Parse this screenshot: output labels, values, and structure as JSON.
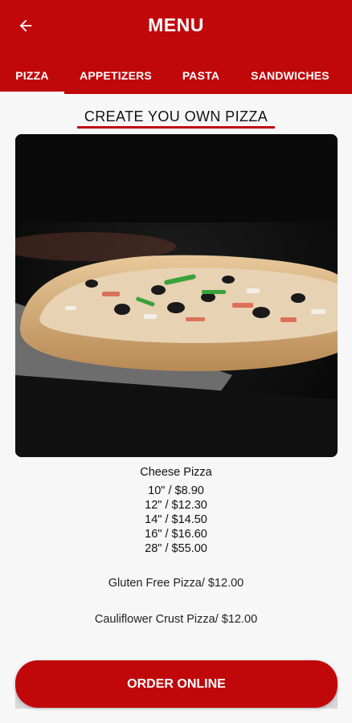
{
  "header": {
    "title": "MENU",
    "back_icon": "arrow-left-icon",
    "color": "#c0080b"
  },
  "tabs": [
    {
      "label": "PIZZA",
      "active": true
    },
    {
      "label": "APPETIZERS",
      "active": false
    },
    {
      "label": "PASTA",
      "active": false
    },
    {
      "label": "SANDWICHES",
      "active": false
    }
  ],
  "section": {
    "title": "CREATE YOU OWN PIZZA"
  },
  "item": {
    "name": "Cheese Pizza",
    "sizes": [
      "10\" / $8.90",
      "12\" / $12.30",
      "14\" / $14.50",
      "16\" / $16.60",
      "28\" / $55.00"
    ],
    "gluten_free": "Gluten Free Pizza/ $12.00",
    "cauliflower": "Cauliflower Crust Pizza/ $12.00"
  },
  "order_button": {
    "label": "ORDER ONLINE"
  }
}
